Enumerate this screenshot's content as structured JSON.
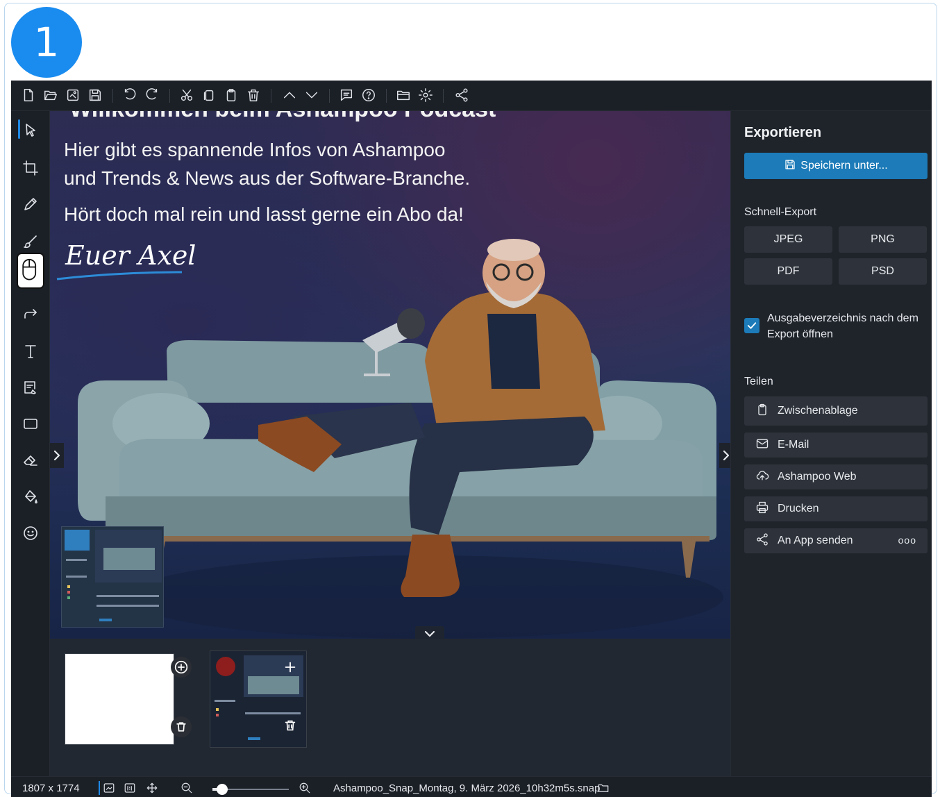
{
  "step_badge": "1",
  "toolbar": {
    "icons": [
      "new-file-icon",
      "open-folder-icon",
      "save-image-icon",
      "save-icon",
      "undo-icon",
      "redo-icon",
      "cut-icon",
      "copy-icon",
      "paste-icon",
      "delete-icon",
      "move-up-icon",
      "move-down-icon",
      "comment-icon",
      "help-icon",
      "folder-icon",
      "settings-icon",
      "share-icon"
    ]
  },
  "left_tools": {
    "icons": [
      "select-icon",
      "crop-icon",
      "pencil-icon",
      "brush-icon",
      "mouse-icon",
      "arrow-icon",
      "text-icon",
      "note-icon",
      "rectangle-icon",
      "eraser-icon",
      "fill-icon",
      "emoji-icon"
    ],
    "active_index": 0
  },
  "canvas": {
    "cut_title": "Willkommen beim Ashampoo Podcast",
    "line1": "Hier gibt es spannende Infos von Ashampoo",
    "line2": "und Trends & News aus der Software-Branche.",
    "line3": "Hört doch mal rein und lasst gerne ein Abo da!",
    "signature": "Euer Axel"
  },
  "panel": {
    "title": "Exportieren",
    "save_label": "Speichern unter...",
    "quick_export_label": "Schnell-Export",
    "formats": [
      "JPEG",
      "PNG",
      "PDF",
      "PSD"
    ],
    "checkbox_checked": true,
    "checkbox_label": "Ausgabeverzeichnis nach dem Export öffnen",
    "share_label": "Teilen",
    "share_items": [
      {
        "label": "Zwischenablage",
        "icon": "clipboard-icon"
      },
      {
        "label": "E-Mail",
        "icon": "mail-icon"
      },
      {
        "label": "Ashampoo Web",
        "icon": "cloud-upload-icon"
      },
      {
        "label": "Drucken",
        "icon": "printer-icon"
      },
      {
        "label": "An App senden",
        "icon": "share-icon"
      }
    ],
    "more_label": "ooo"
  },
  "status": {
    "dimensions": "1807 x 1774",
    "zoom_fraction": 0.13,
    "filename": "Ashampoo_Snap_Montag, 9. März 2026_10h32m5s.snap"
  },
  "colors": {
    "accent": "#1c7bb8",
    "background": "#1b1f26",
    "badge": "#1a8cf0"
  }
}
